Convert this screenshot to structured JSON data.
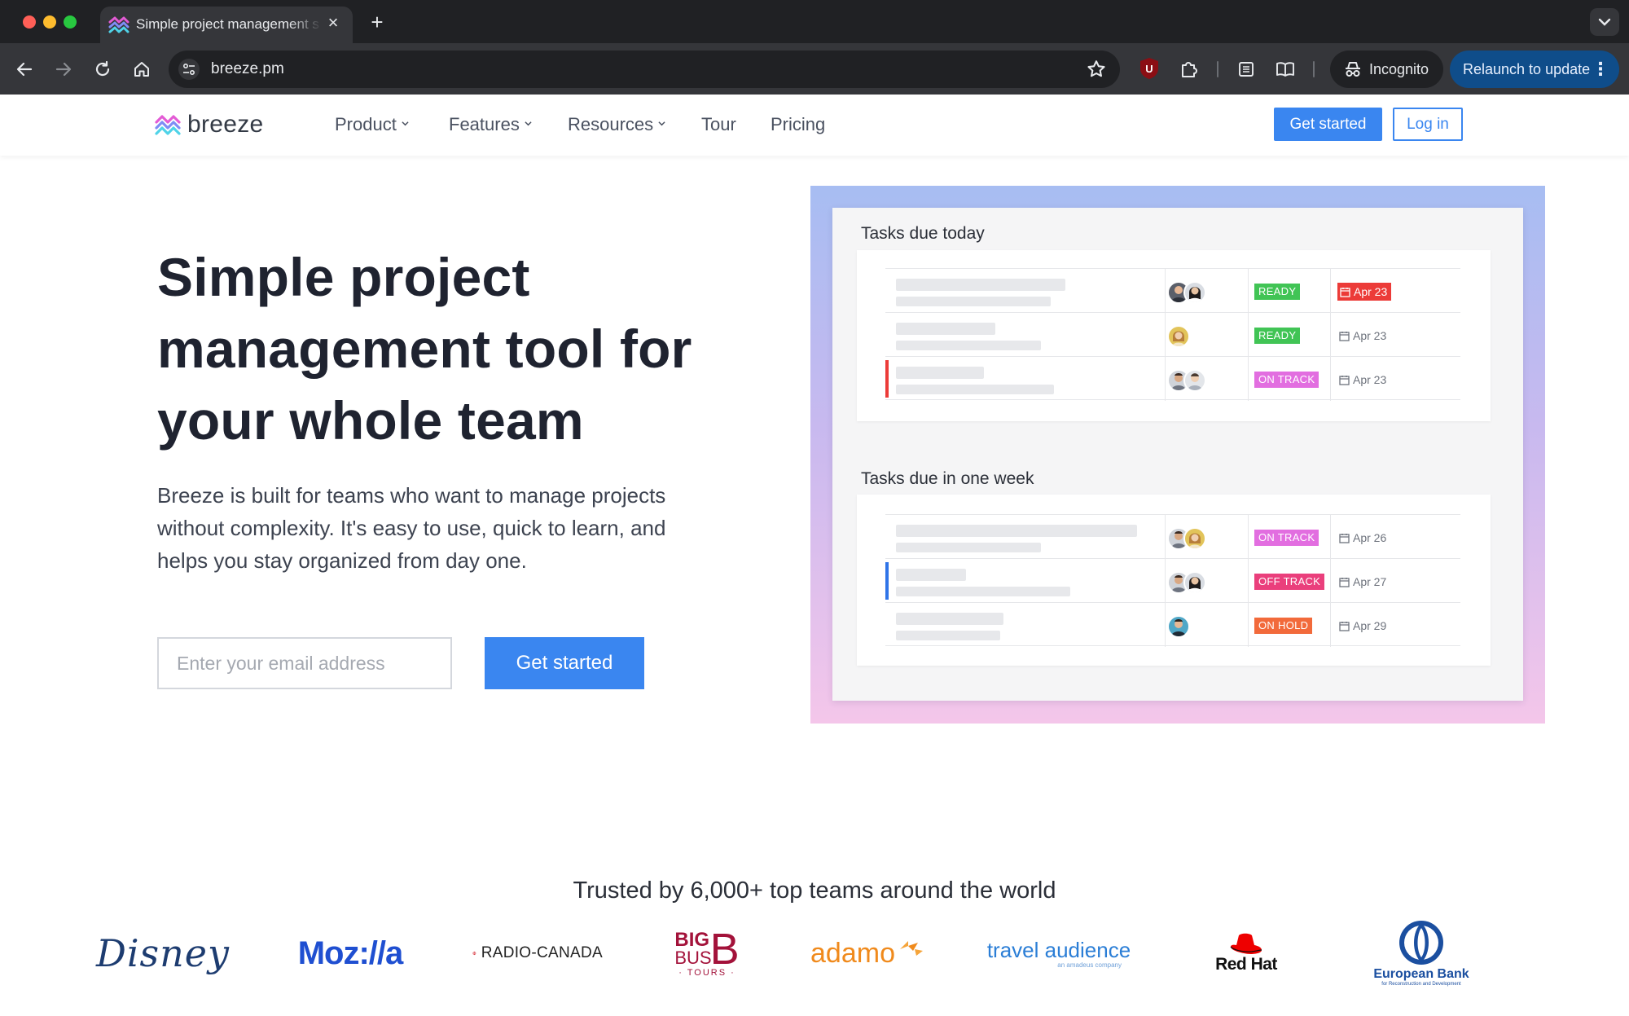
{
  "browser": {
    "tab_title": "Simple project management s",
    "new_tab_symbol": "+",
    "close_symbol": "×",
    "url": "breeze.pm",
    "incognito_label": "Incognito",
    "relaunch_label": "Relaunch to update",
    "ublock_letter": "U"
  },
  "nav": {
    "logo_text": "breeze",
    "items": [
      {
        "label": "Product",
        "dropdown": true
      },
      {
        "label": "Features",
        "dropdown": true
      },
      {
        "label": "Resources",
        "dropdown": true
      },
      {
        "label": "Tour",
        "dropdown": false
      },
      {
        "label": "Pricing",
        "dropdown": false
      }
    ],
    "get_started": "Get started",
    "login": "Log in"
  },
  "hero": {
    "title_lines": [
      "Simple project",
      "management tool for",
      "your whole team"
    ],
    "desc_lines": [
      "Breeze is built for teams who want to manage projects",
      "without complexity. It's easy to use, quick to learn, and",
      "helps you stay organized from day one."
    ],
    "email_placeholder": "Enter your email address",
    "cta": "Get started"
  },
  "mockup": {
    "today_title": "Tasks due today",
    "week_title": "Tasks due in one week",
    "today_rows": [
      {
        "status": "READY",
        "status_color": "#41c455",
        "due": "Apr 23",
        "overdue": true
      },
      {
        "status": "READY",
        "status_color": "#41c455",
        "due": "Apr 23",
        "overdue": false
      },
      {
        "status": "ON TRACK",
        "status_color": "#e26ee0",
        "due": "Apr 23",
        "overdue": false
      }
    ],
    "week_rows": [
      {
        "status": "ON TRACK",
        "status_color": "#e26ee0",
        "due": "Apr 26",
        "overdue": false
      },
      {
        "status": "OFF TRACK",
        "status_color": "#ea3f7c",
        "due": "Apr 27",
        "overdue": false
      },
      {
        "status": "ON HOLD",
        "status_color": "#f26a3b",
        "due": "Apr 29",
        "overdue": false
      }
    ]
  },
  "trusted": {
    "heading": "Trusted by 6,000+ top teams around the world",
    "logos": {
      "disney": "Disney",
      "mozilla": "Moz://a",
      "radiocanada": "RADIO-CANADA",
      "bigbus_big": "BIG",
      "bigbus_bus": "BUS",
      "bigbus_tours": "· TOURS ·",
      "adamo": "adamo",
      "travel": "travel audience",
      "travel_sub": "an amadeus company",
      "redhat": "Red Hat",
      "ebrd": "European Bank",
      "ebrd_sub": "for Reconstruction and Development"
    }
  },
  "colors": {
    "accent": "#3a86f0",
    "overdue": "#ec3b38"
  }
}
